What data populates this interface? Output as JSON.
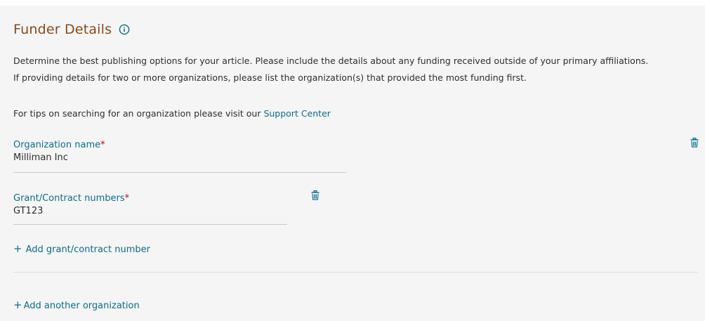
{
  "section": {
    "title": "Funder Details",
    "info_icon": "info-circle-icon"
  },
  "description": {
    "line1": "Determine the best publishing options for your article. Please include the details about any funding received outside of your primary affiliations.",
    "line2": "If providing details for two or more organizations, please list the organization(s) that provided the most funding first."
  },
  "tips": {
    "prefix": "For tips on searching for an organization please visit our ",
    "link_text": "Support Center"
  },
  "organization": {
    "label": "Organization name",
    "required_marker": "*",
    "value": "Milliman Inc",
    "delete_icon": "trash-icon"
  },
  "grant": {
    "label": "Grant/Contract numbers",
    "required_marker": "*",
    "value": "GT123",
    "delete_icon": "trash-icon"
  },
  "actions": {
    "add_grant_plus": "+",
    "add_grant_label": "Add grant/contract number",
    "add_org_plus": "+",
    "add_org_label": "Add another organization"
  },
  "colors": {
    "title": "#8a4a1b",
    "link": "#0b6d8a",
    "required": "#c4001d",
    "panel_bg": "#f5f5f5"
  }
}
